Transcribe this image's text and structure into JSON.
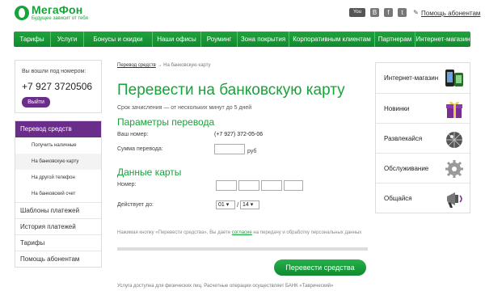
{
  "header": {
    "logo_name": "МегаФон",
    "logo_slogan": "Будущее зависит от тебя",
    "social_icons": [
      "youtube-icon",
      "blog-icon",
      "facebook-icon",
      "twitter-icon",
      "edit-icon"
    ],
    "youtube_text": "You Tube",
    "help_link": "Помощь абонентам"
  },
  "nav": {
    "items": [
      "Тарифы",
      "Услуги",
      "Бонусы и скидки",
      "Наши офисы",
      "Роуминг",
      "Зона покрытия",
      "Корпоративным клиентам",
      "Партнерам",
      "Интернет-магазин"
    ]
  },
  "login": {
    "label": "Вы вошли под номером:",
    "phone": "+7 927 3720506",
    "logout": "Выйти"
  },
  "menu": {
    "active": "Перевод средств",
    "subitems": [
      "Получить наличные",
      "На банковскую карту",
      "На другой телефон",
      "На банковский счет"
    ],
    "items": [
      "Шаблоны платежей",
      "История платежей",
      "Тарифы",
      "Помощь абонентам"
    ]
  },
  "main": {
    "breadcrumb_link": "Перевод средств",
    "breadcrumb_arrow": "→",
    "breadcrumb_current": "На банковскую карту",
    "title": "Перевести на банковскую карту",
    "term": "Срок зачисления — от нескольких минут до 5 дней",
    "params_heading": "Параметры перевода",
    "your_number_label": "Ваш номер:",
    "your_number_value": "(+7 927) 372-05-06",
    "amount_label": "Сумма перевода:",
    "currency": "руб",
    "card_heading": "Данные карты",
    "card_number_label": "Номер:",
    "valid_label": "Действует до:",
    "month": "01",
    "year": "14",
    "notice_before": "Нажимая кнопку «Перевести средства», Вы даете ",
    "notice_link": "согласие",
    "notice_after": " на передачу и обработку персональных данных",
    "progress": 0.0,
    "submit": "Перевести средства",
    "footnote": "Услуга доступна для физических лиц. Расчетные операции осуществляет БАНК «Таврический»"
  },
  "promo": {
    "items": [
      {
        "label": "Интернет-магазин",
        "icon": "phones-icon"
      },
      {
        "label": "Новинки",
        "icon": "gift-icon"
      },
      {
        "label": "Развлекайся",
        "icon": "disco-ball-icon"
      },
      {
        "label": "Обслуживание",
        "icon": "gear-icon"
      },
      {
        "label": "Общайся",
        "icon": "megaphone-icon"
      }
    ]
  },
  "colors": {
    "brand_green": "#16a33a",
    "brand_purple": "#6b2d8a"
  }
}
